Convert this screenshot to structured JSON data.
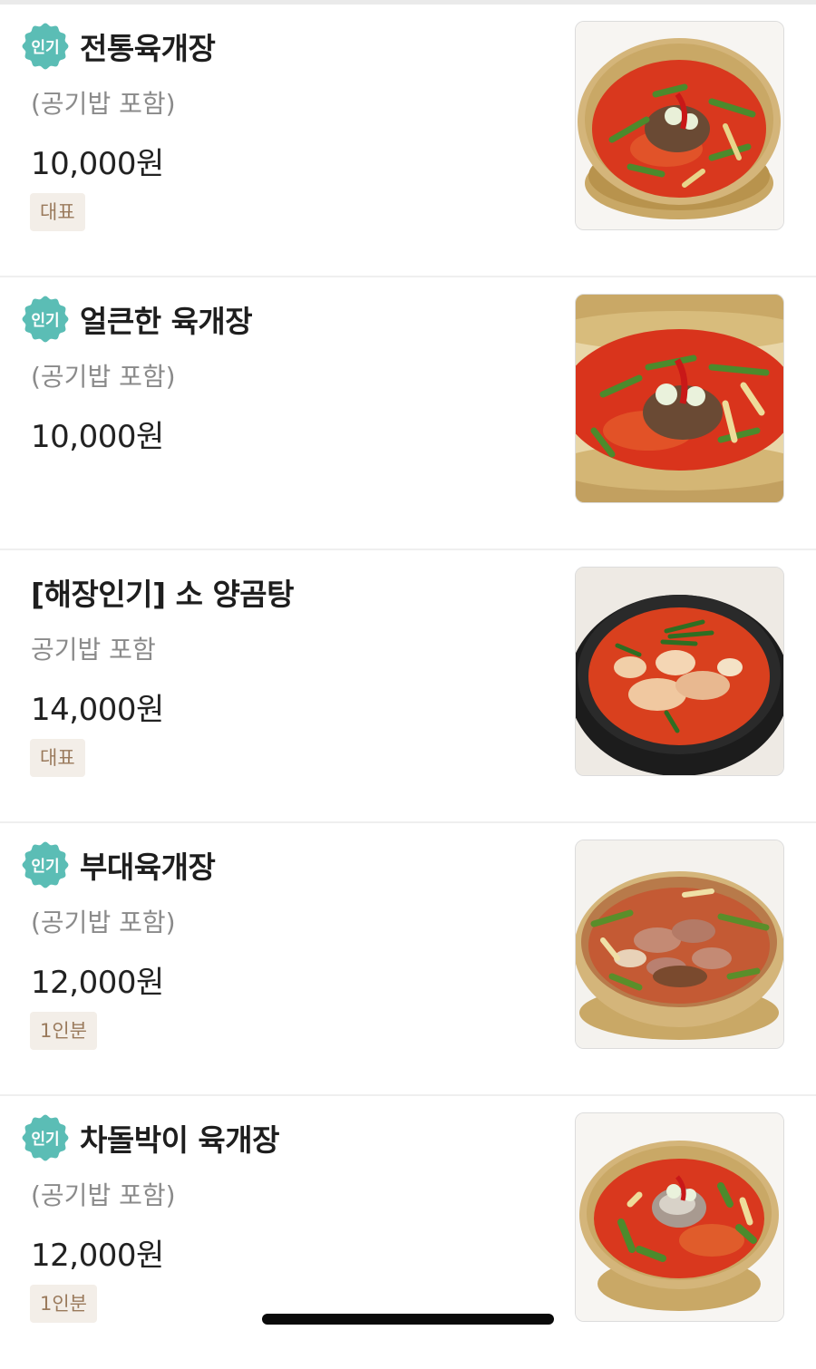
{
  "badge_label": "인기",
  "colors": {
    "badge": "#5bbdb5",
    "tag_bg": "#f3eee8",
    "tag_text": "#9a7a5c",
    "broth": "#d9381e",
    "brass_bowl": "#c9a866",
    "stone_pot": "#1c1c1c"
  },
  "items": [
    {
      "has_badge": true,
      "name": "전통육개장",
      "desc": "(공기밥 포함)",
      "price": "10,000원",
      "tag": "대표",
      "image": "yukgaejang-brass-bowl-photo"
    },
    {
      "has_badge": true,
      "name": "얼큰한 육개장",
      "desc": "(공기밥 포함)",
      "price": "10,000원",
      "tag": "",
      "image": "spicy-yukgaejang-closeup-photo"
    },
    {
      "has_badge": false,
      "name": "[해장인기] 소 양곰탕",
      "desc": "공기밥 포함",
      "price": "14,000원",
      "tag": "대표",
      "image": "tripe-soup-stone-pot-photo"
    },
    {
      "has_badge": true,
      "name": "부대육개장",
      "desc": "(공기밥 포함)",
      "price": "12,000원",
      "tag": "1인분",
      "image": "budae-yukgaejang-photo"
    },
    {
      "has_badge": true,
      "name": "차돌박이 육개장",
      "desc": "(공기밥 포함)",
      "price": "12,000원",
      "tag": "1인분",
      "image": "brisket-yukgaejang-photo"
    }
  ]
}
